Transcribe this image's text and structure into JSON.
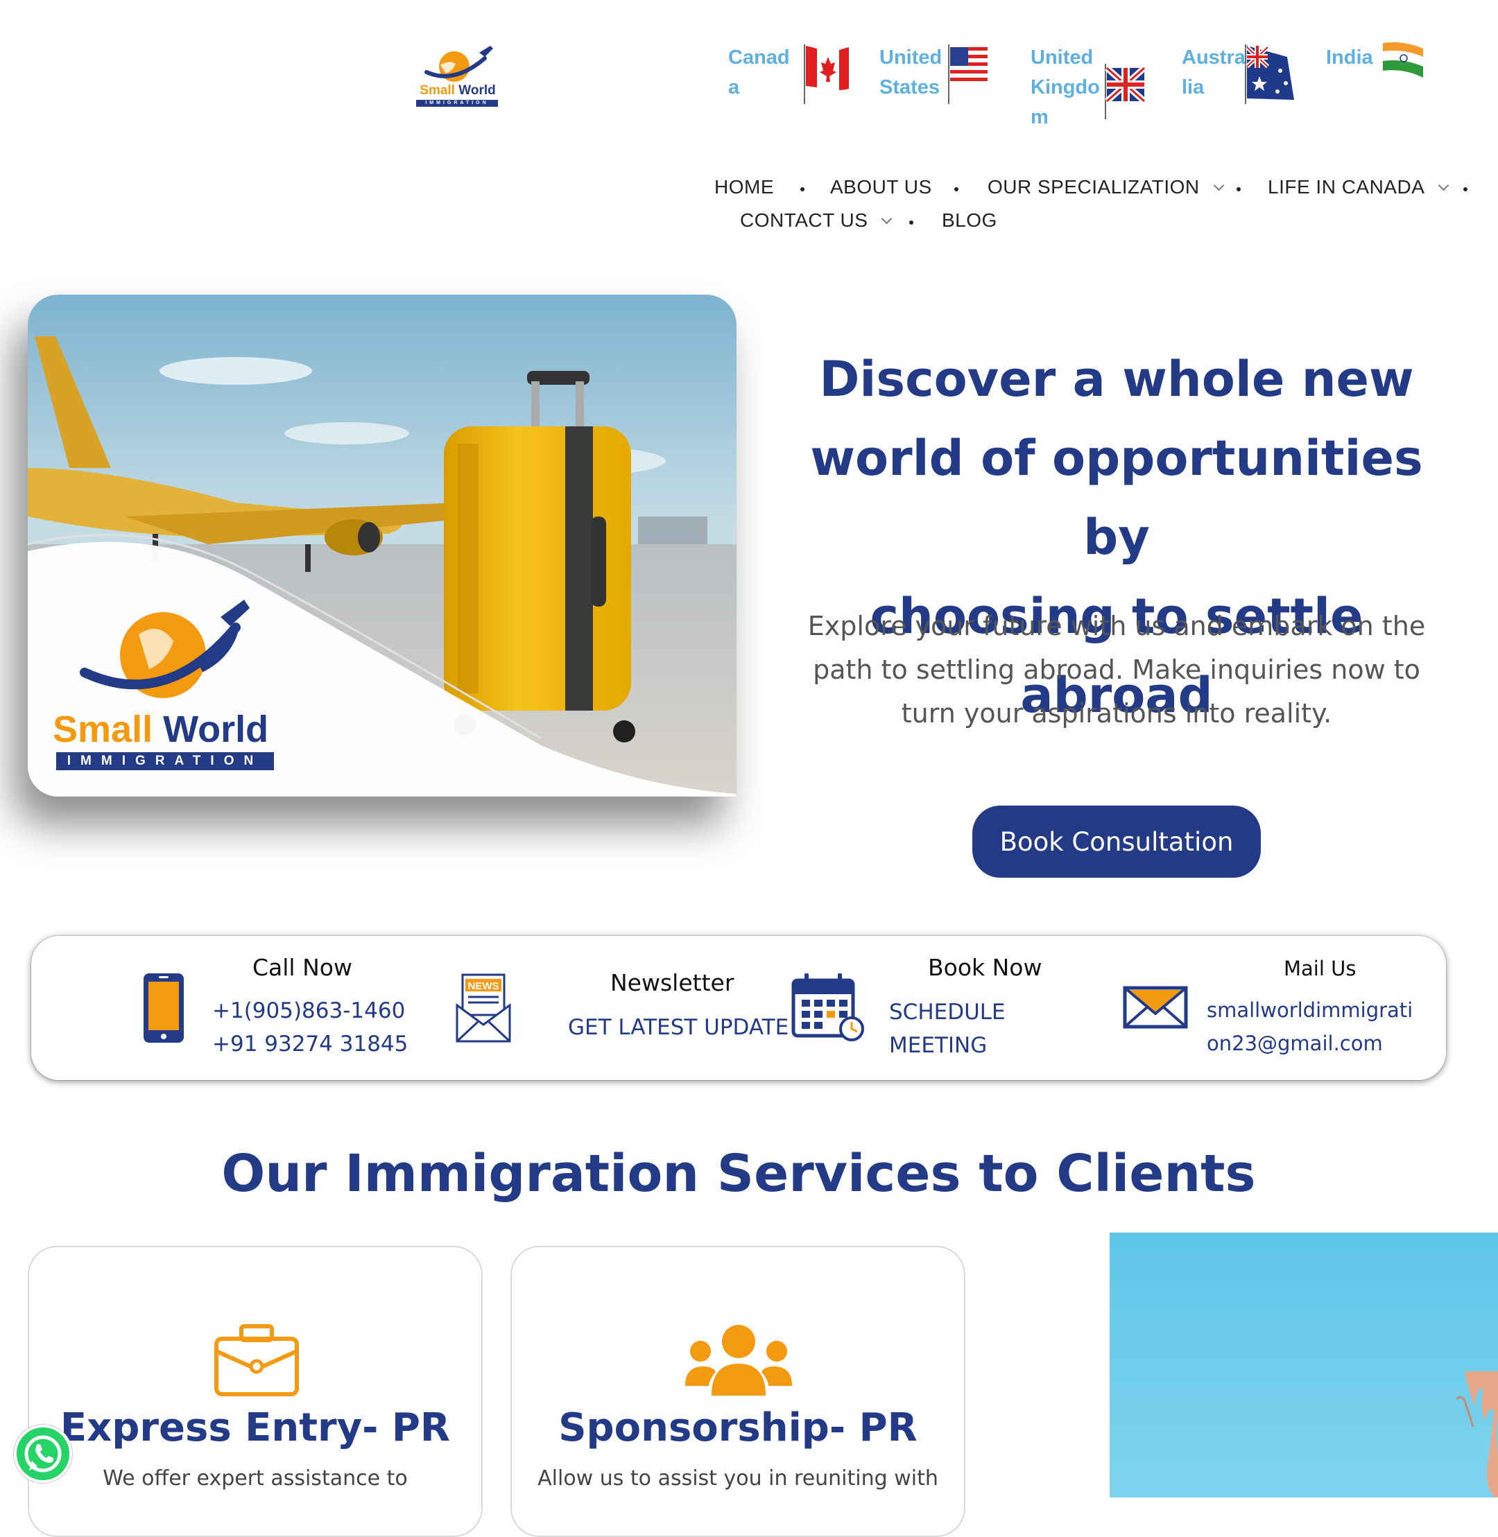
{
  "logo": {
    "brand_a": "Small",
    "brand_b": "World",
    "sub": "IMMIGRATION"
  },
  "countries": [
    {
      "label": "Canada"
    },
    {
      "label": "United States"
    },
    {
      "label": "United Kingdom"
    },
    {
      "label": "Australia"
    },
    {
      "label": "India"
    }
  ],
  "nav": {
    "home": "HOME",
    "about": "ABOUT US",
    "specialization": "OUR SPECIALIZATION",
    "life": "LIFE IN CANADA",
    "contact": "CONTACT US",
    "blog": "BLOG"
  },
  "hero": {
    "title_lines": [
      "Discover a whole new",
      "world of opportunities by",
      "choosing to settle abroad"
    ],
    "subtitle_lines": [
      "Explore your future with us and embark on the",
      "path to settling abroad. Make inquiries now to",
      "turn your aspirations into reality."
    ],
    "cta": "Book Consultation",
    "card_brand_a": "Small",
    "card_brand_b": "World",
    "card_sub": "IMMIGRATION"
  },
  "contact_strip": {
    "call": {
      "title": "Call Now",
      "phone1": "+1(905)863-1460",
      "phone2": "+91 93274 31845"
    },
    "newsletter": {
      "title": "Newsletter",
      "line": "GET LATEST UPDATE",
      "icon_text": "NEWS"
    },
    "book": {
      "title": "Book Now",
      "line1": "SCHEDULE",
      "line2": "MEETING"
    },
    "mail": {
      "title": "Mail Us",
      "line1": "smallworldimmigrati",
      "line2": "on23@gmail.com"
    }
  },
  "services": {
    "title": "Our Immigration Services to Clients",
    "cards": [
      {
        "title": "Express Entry- PR",
        "desc": "We offer expert assistance to"
      },
      {
        "title": "Sponsorship- PR",
        "desc": "Allow us to assist you in reuniting with"
      }
    ]
  },
  "colors": {
    "navy": "#233a86",
    "orange": "#f39a10",
    "country_blue": "#5eb0e0",
    "whatsapp": "#25d366"
  }
}
